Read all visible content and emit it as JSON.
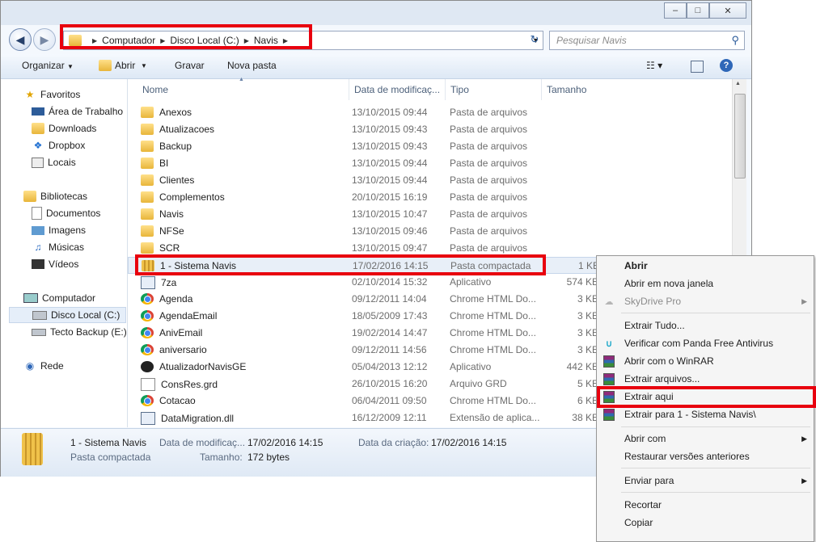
{
  "address": {
    "crumbs": [
      "Computador",
      "Disco Local (C:)",
      "Navis"
    ]
  },
  "search": {
    "placeholder": "Pesquisar Navis"
  },
  "toolbar": {
    "organize": "Organizar",
    "open": "Abrir",
    "burn": "Gravar",
    "new_folder": "Nova pasta"
  },
  "sidebar": {
    "favorites": "Favoritos",
    "fav_items": [
      "Área de Trabalho",
      "Downloads",
      "Dropbox",
      "Locais"
    ],
    "libraries": "Bibliotecas",
    "lib_items": [
      "Documentos",
      "Imagens",
      "Músicas",
      "Vídeos"
    ],
    "computer": "Computador",
    "comp_items": [
      "Disco Local (C:)",
      "Tecto Backup (E:)"
    ],
    "network": "Rede"
  },
  "columns": {
    "name": "Nome",
    "date": "Data de modificaç...",
    "type": "Tipo",
    "size": "Tamanho"
  },
  "files": [
    {
      "name": "Anexos",
      "date": "13/10/2015 09:44",
      "type": "Pasta de arquivos",
      "size": "",
      "icon": "folder"
    },
    {
      "name": "Atualizacoes",
      "date": "13/10/2015 09:43",
      "type": "Pasta de arquivos",
      "size": "",
      "icon": "folder"
    },
    {
      "name": "Backup",
      "date": "13/10/2015 09:43",
      "type": "Pasta de arquivos",
      "size": "",
      "icon": "folder"
    },
    {
      "name": "BI",
      "date": "13/10/2015 09:44",
      "type": "Pasta de arquivos",
      "size": "",
      "icon": "folder"
    },
    {
      "name": "Clientes",
      "date": "13/10/2015 09:44",
      "type": "Pasta de arquivos",
      "size": "",
      "icon": "folder"
    },
    {
      "name": "Complementos",
      "date": "20/10/2015 16:19",
      "type": "Pasta de arquivos",
      "size": "",
      "icon": "folder"
    },
    {
      "name": "Navis",
      "date": "13/10/2015 10:47",
      "type": "Pasta de arquivos",
      "size": "",
      "icon": "folder"
    },
    {
      "name": "NFSe",
      "date": "13/10/2015 09:46",
      "type": "Pasta de arquivos",
      "size": "",
      "icon": "folder"
    },
    {
      "name": "SCR",
      "date": "13/10/2015 09:47",
      "type": "Pasta de arquivos",
      "size": "",
      "icon": "folder"
    },
    {
      "name": "1 - Sistema Navis",
      "date": "17/02/2016 14:15",
      "type": "Pasta compactada",
      "size": "1 KE",
      "icon": "zip"
    },
    {
      "name": "7za",
      "date": "02/10/2014 15:32",
      "type": "Aplicativo",
      "size": "574 KE",
      "icon": "app"
    },
    {
      "name": "Agenda",
      "date": "09/12/2011 14:04",
      "type": "Chrome HTML Do...",
      "size": "3 KE",
      "icon": "chrome"
    },
    {
      "name": "AgendaEmail",
      "date": "18/05/2009 17:43",
      "type": "Chrome HTML Do...",
      "size": "3 KE",
      "icon": "chrome"
    },
    {
      "name": "AnivEmail",
      "date": "19/02/2014 14:47",
      "type": "Chrome HTML Do...",
      "size": "3 KE",
      "icon": "chrome"
    },
    {
      "name": "aniversario",
      "date": "09/12/2011 14:56",
      "type": "Chrome HTML Do...",
      "size": "3 KE",
      "icon": "chrome"
    },
    {
      "name": "AtualizadorNavisGE",
      "date": "05/04/2013 12:12",
      "type": "Aplicativo",
      "size": "442 KE",
      "icon": "dark"
    },
    {
      "name": "ConsRes.grd",
      "date": "26/10/2015 16:20",
      "type": "Arquivo GRD",
      "size": "5 KE",
      "icon": "doc"
    },
    {
      "name": "Cotacao",
      "date": "06/04/2011 09:50",
      "type": "Chrome HTML Do...",
      "size": "6 KE",
      "icon": "chrome"
    },
    {
      "name": "DataMigration.dll",
      "date": "16/12/2009 12:11",
      "type": "Extensão de aplica...",
      "size": "38 KE",
      "icon": "app"
    }
  ],
  "status": {
    "name": "1 - Sistema Navis",
    "type": "Pasta compactada",
    "modified_label": "Data de modificaç...",
    "modified": "17/02/2016 14:15",
    "created_label": "Data da criação:",
    "created": "17/02/2016 14:15",
    "size_label": "Tamanho:",
    "size": "172 bytes"
  },
  "context_menu": {
    "items": [
      {
        "label": "Abrir",
        "bold": true
      },
      {
        "label": "Abrir em nova janela"
      },
      {
        "label": "SkyDrive Pro",
        "disabled": true,
        "submenu": true
      },
      {
        "label": "Extrair Tudo..."
      },
      {
        "label": "Verificar com Panda Free Antivirus"
      },
      {
        "label": "Abrir com o WinRAR"
      },
      {
        "label": "Extrair arquivos..."
      },
      {
        "label": "Extrair aqui"
      },
      {
        "label": "Extrair para 1 - Sistema Navis\\"
      },
      {
        "label": "Abrir com",
        "submenu": true
      },
      {
        "label": "Restaurar versões anteriores"
      },
      {
        "label": "Enviar para",
        "submenu": true
      },
      {
        "label": "Recortar"
      },
      {
        "label": "Copiar"
      }
    ]
  },
  "colors": {
    "highlight": "#e8000e",
    "selection": "#e8eff8",
    "window_bg": "#f4f8fd"
  }
}
